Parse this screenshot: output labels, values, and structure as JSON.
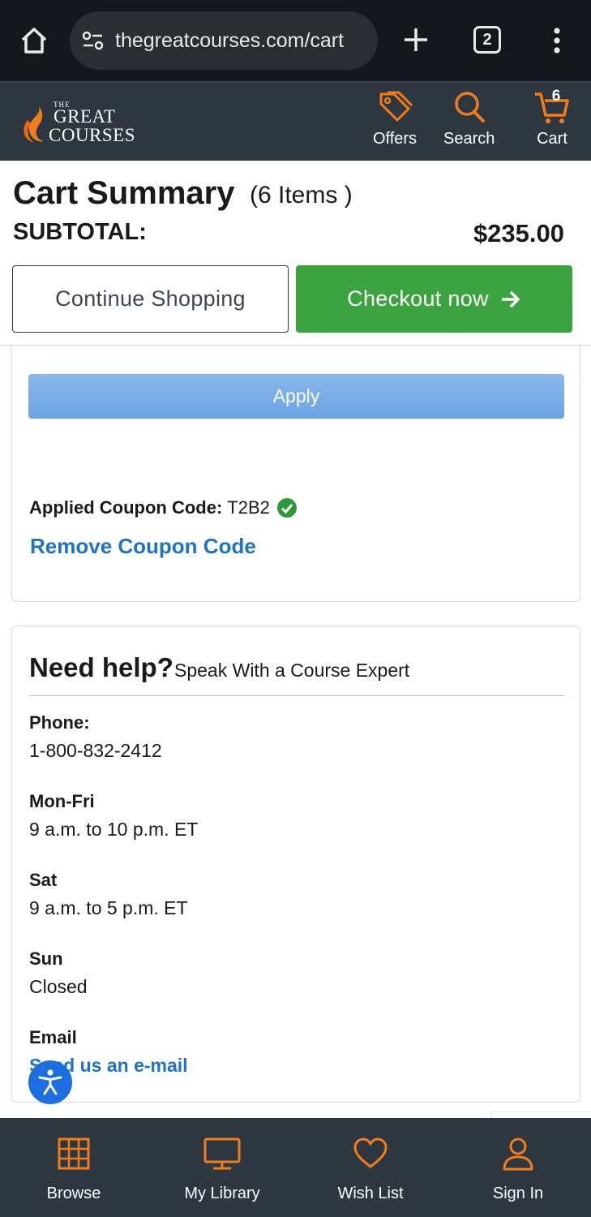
{
  "browser": {
    "url": "thegreatcourses.com/cart",
    "tab_count": "2"
  },
  "header": {
    "logo": {
      "the": "THE",
      "great": "GREAT",
      "courses": "COURSES"
    },
    "offers_label": "Offers",
    "search_label": "Search",
    "cart_label": "Cart",
    "cart_count": "6",
    "accent_color": "#f07c1c"
  },
  "cart_summary": {
    "title": "Cart Summary",
    "item_count": "(6 Items )",
    "subtotal_label": "SUBTOTAL:",
    "subtotal_value": "$235.00",
    "continue_label": "Continue Shopping",
    "checkout_label": "Checkout now"
  },
  "coupon": {
    "apply_label": "Apply",
    "applied_label": "Applied Coupon Code:",
    "applied_code": "T2B2",
    "remove_label": "Remove Coupon Code"
  },
  "help": {
    "title": "Need help?",
    "subtitle": "Speak With a Course Expert",
    "phone_label": "Phone:",
    "phone_value": "1-800-832-2412",
    "monfri_label": "Mon-Fri",
    "monfri_value": "9 a.m. to 10 p.m. ET",
    "sat_label": "Sat",
    "sat_value": "9 a.m. to 5 p.m. ET",
    "sun_label": "Sun",
    "sun_value": "Closed",
    "email_label": "Email",
    "email_link": "Send us an e-mail"
  },
  "bottom_nav": {
    "browse": "Browse",
    "library": "My Library",
    "wishlist": "Wish List",
    "signin": "Sign In"
  }
}
